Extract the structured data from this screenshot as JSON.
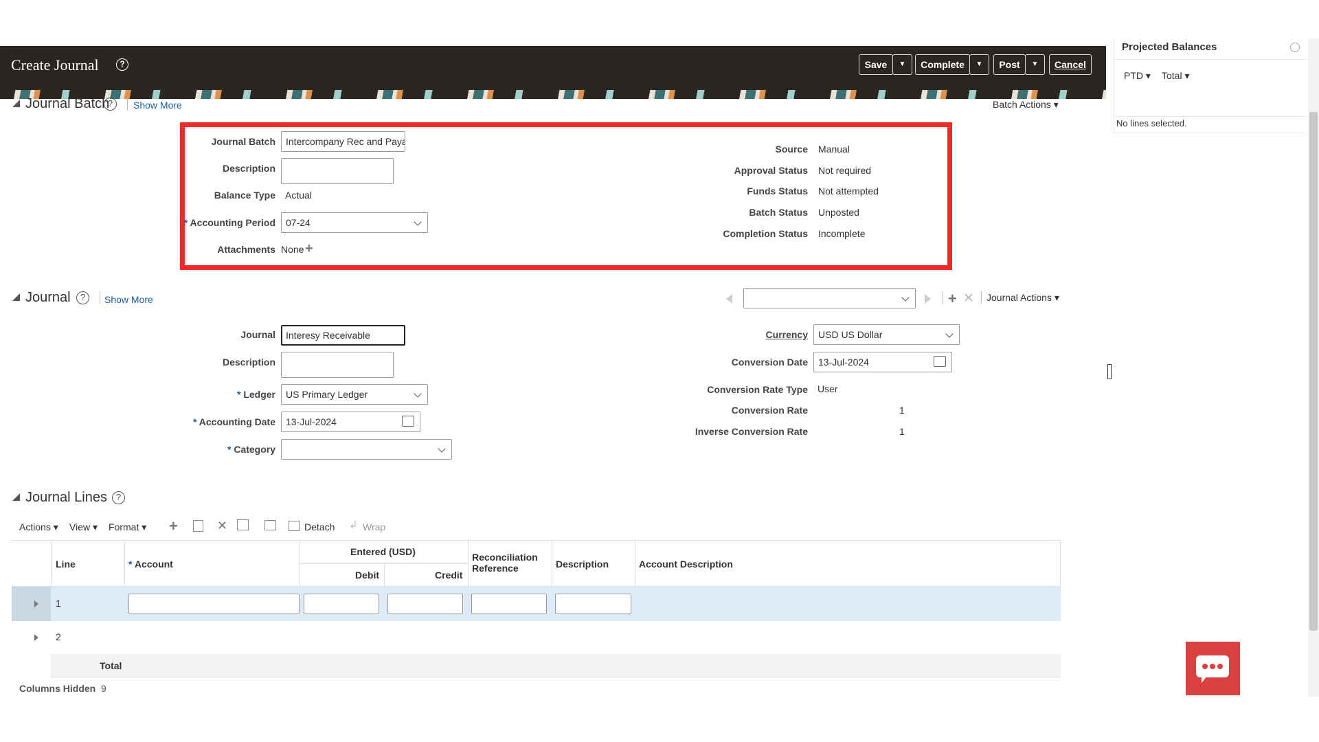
{
  "header": {
    "title": "Create Journal",
    "buttons": {
      "save": "Save",
      "complete": "Complete",
      "post": "Post",
      "cancel": "Cancel",
      "arrow": "▼"
    }
  },
  "right_panel": {
    "title": "Projected Balances",
    "ptd": "PTD",
    "total": "Total",
    "no_lines": "No lines selected."
  },
  "batch": {
    "section_title": "Journal Batch",
    "show_more": "Show More",
    "batch_actions": "Batch Actions",
    "fields": {
      "journal_batch_label": "Journal Batch",
      "journal_batch_value": "Intercompany Rec and Paya",
      "description_label": "Description",
      "balance_type_label": "Balance Type",
      "balance_type_value": "Actual",
      "accounting_period_label": "Accounting Period",
      "accounting_period_value": "07-24",
      "attachments_label": "Attachments",
      "attachments_value": "None"
    },
    "status": {
      "source_label": "Source",
      "source_value": "Manual",
      "approval_label": "Approval Status",
      "approval_value": "Not required",
      "funds_label": "Funds Status",
      "funds_value": "Not attempted",
      "batch_status_label": "Batch Status",
      "batch_status_value": "Unposted",
      "completion_label": "Completion Status",
      "completion_value": "Incomplete"
    }
  },
  "journal": {
    "section_title": "Journal",
    "show_more": "Show More",
    "journal_actions": "Journal Actions",
    "fields": {
      "journal_label": "Journal",
      "journal_value": "Interesy Receivable",
      "description_label": "Description",
      "ledger_label": "Ledger",
      "ledger_value": "US Primary Ledger",
      "accounting_date_label": "Accounting Date",
      "accounting_date_value": "13-Jul-2024",
      "category_label": "Category",
      "category_value": ""
    },
    "currency": {
      "currency_label": "Currency",
      "currency_value": "USD US Dollar",
      "conversion_date_label": "Conversion Date",
      "conversion_date_value": "13-Jul-2024",
      "rate_type_label": "Conversion Rate Type",
      "rate_type_value": "User",
      "rate_label": "Conversion Rate",
      "rate_value": "1",
      "inverse_label": "Inverse Conversion Rate",
      "inverse_value": "1"
    }
  },
  "lines": {
    "section_title": "Journal Lines",
    "toolbar": {
      "actions": "Actions",
      "view": "View",
      "format": "Format",
      "detach": "Detach",
      "wrap": "Wrap"
    },
    "columns": {
      "line": "Line",
      "account": "Account",
      "entered": "Entered (USD)",
      "debit": "Debit",
      "credit": "Credit",
      "recon_ref": "Reconciliation Reference",
      "description": "Description",
      "account_desc": "Account Description"
    },
    "rows": [
      {
        "line": "1"
      },
      {
        "line": "2"
      }
    ],
    "total_label": "Total",
    "columns_hidden_label": "Columns Hidden",
    "columns_hidden_value": "9"
  },
  "required_marker": "*"
}
